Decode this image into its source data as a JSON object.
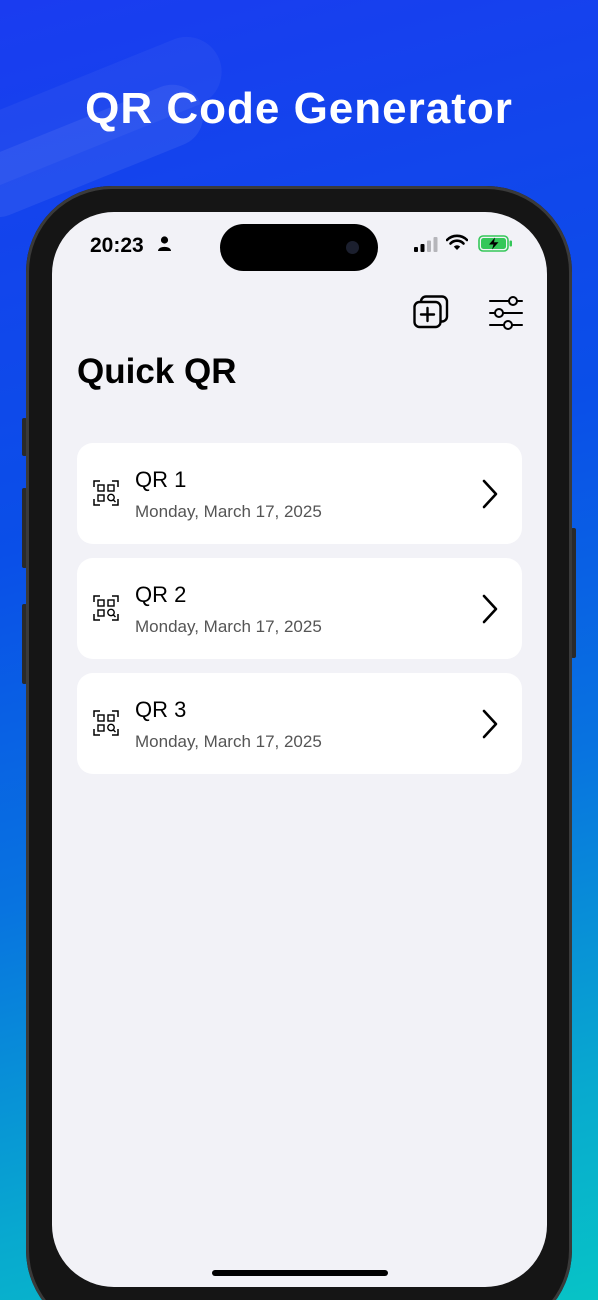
{
  "headline": "QR Code Generator",
  "status_bar": {
    "time": "20:23"
  },
  "toolbar": {
    "add_icon": "add-stack-icon",
    "settings_icon": "sliders-icon"
  },
  "page_title": "Quick QR",
  "qr_list": [
    {
      "name": "QR 1",
      "date": "Monday, March 17, 2025"
    },
    {
      "name": "QR 2",
      "date": "Monday, March 17, 2025"
    },
    {
      "name": "QR 3",
      "date": "Monday, March 17, 2025"
    }
  ],
  "colors": {
    "background_top": "#1a3cf0",
    "background_bottom": "#07c3c6",
    "screen_bg": "#f2f2f7",
    "card_bg": "#ffffff",
    "battery_green": "#34c759"
  }
}
